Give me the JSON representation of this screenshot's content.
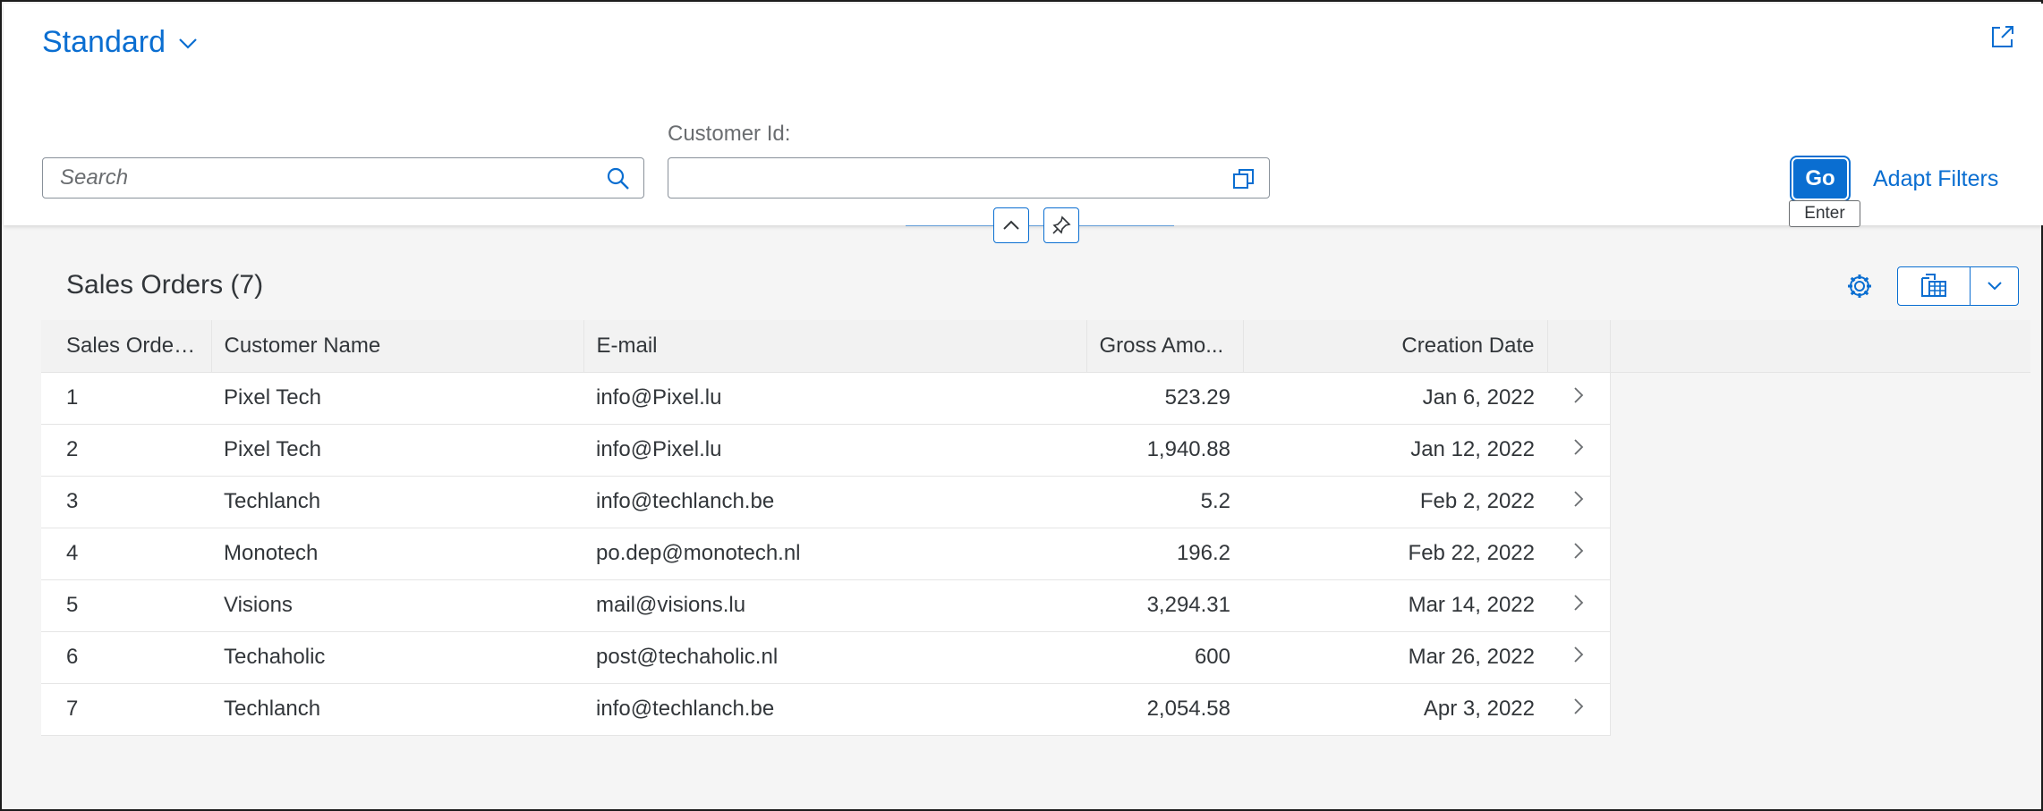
{
  "variant": {
    "title": "Standard"
  },
  "filter_bar": {
    "search_placeholder": "Search",
    "customer_id_label": "Customer Id:",
    "customer_id_value": "",
    "go_label": "Go",
    "go_tooltip": "Enter",
    "adapt_filters_label": "Adapt Filters"
  },
  "table": {
    "title": "Sales Orders (7)",
    "columns": [
      "Sales Order Id",
      "Customer Name",
      "E-mail",
      "Gross Amo...",
      "Creation Date"
    ],
    "rows": [
      [
        "1",
        "Pixel Tech",
        "info@Pixel.lu",
        "523.29",
        "Jan 6, 2022"
      ],
      [
        "2",
        "Pixel Tech",
        "info@Pixel.lu",
        "1,940.88",
        "Jan 12, 2022"
      ],
      [
        "3",
        "Techlanch",
        "info@techlanch.be",
        "5.2",
        "Feb 2, 2022"
      ],
      [
        "4",
        "Monotech",
        "po.dep@monotech.nl",
        "196.2",
        "Feb 22, 2022"
      ],
      [
        "5",
        "Visions",
        "mail@visions.lu",
        "3,294.31",
        "Mar 14, 2022"
      ],
      [
        "6",
        "Techaholic",
        "post@techaholic.nl",
        "600",
        "Mar 26, 2022"
      ],
      [
        "7",
        "Techlanch",
        "info@techlanch.be",
        "2,054.58",
        "Apr 3, 2022"
      ]
    ]
  },
  "colors": {
    "accent": "#0a6ed1",
    "text": "#32363a",
    "muted": "#6a6d70",
    "background": "#f5f5f5"
  },
  "icons": {
    "variant": "chevron-down-icon",
    "share": "share-icon",
    "search": "search-icon",
    "value_help": "value-help-icon",
    "collapse": "chevron-up-icon",
    "pin": "pin-icon",
    "settings": "gear-icon",
    "export": "spreadsheet-export-icon",
    "row_nav": "chevron-right-icon"
  }
}
